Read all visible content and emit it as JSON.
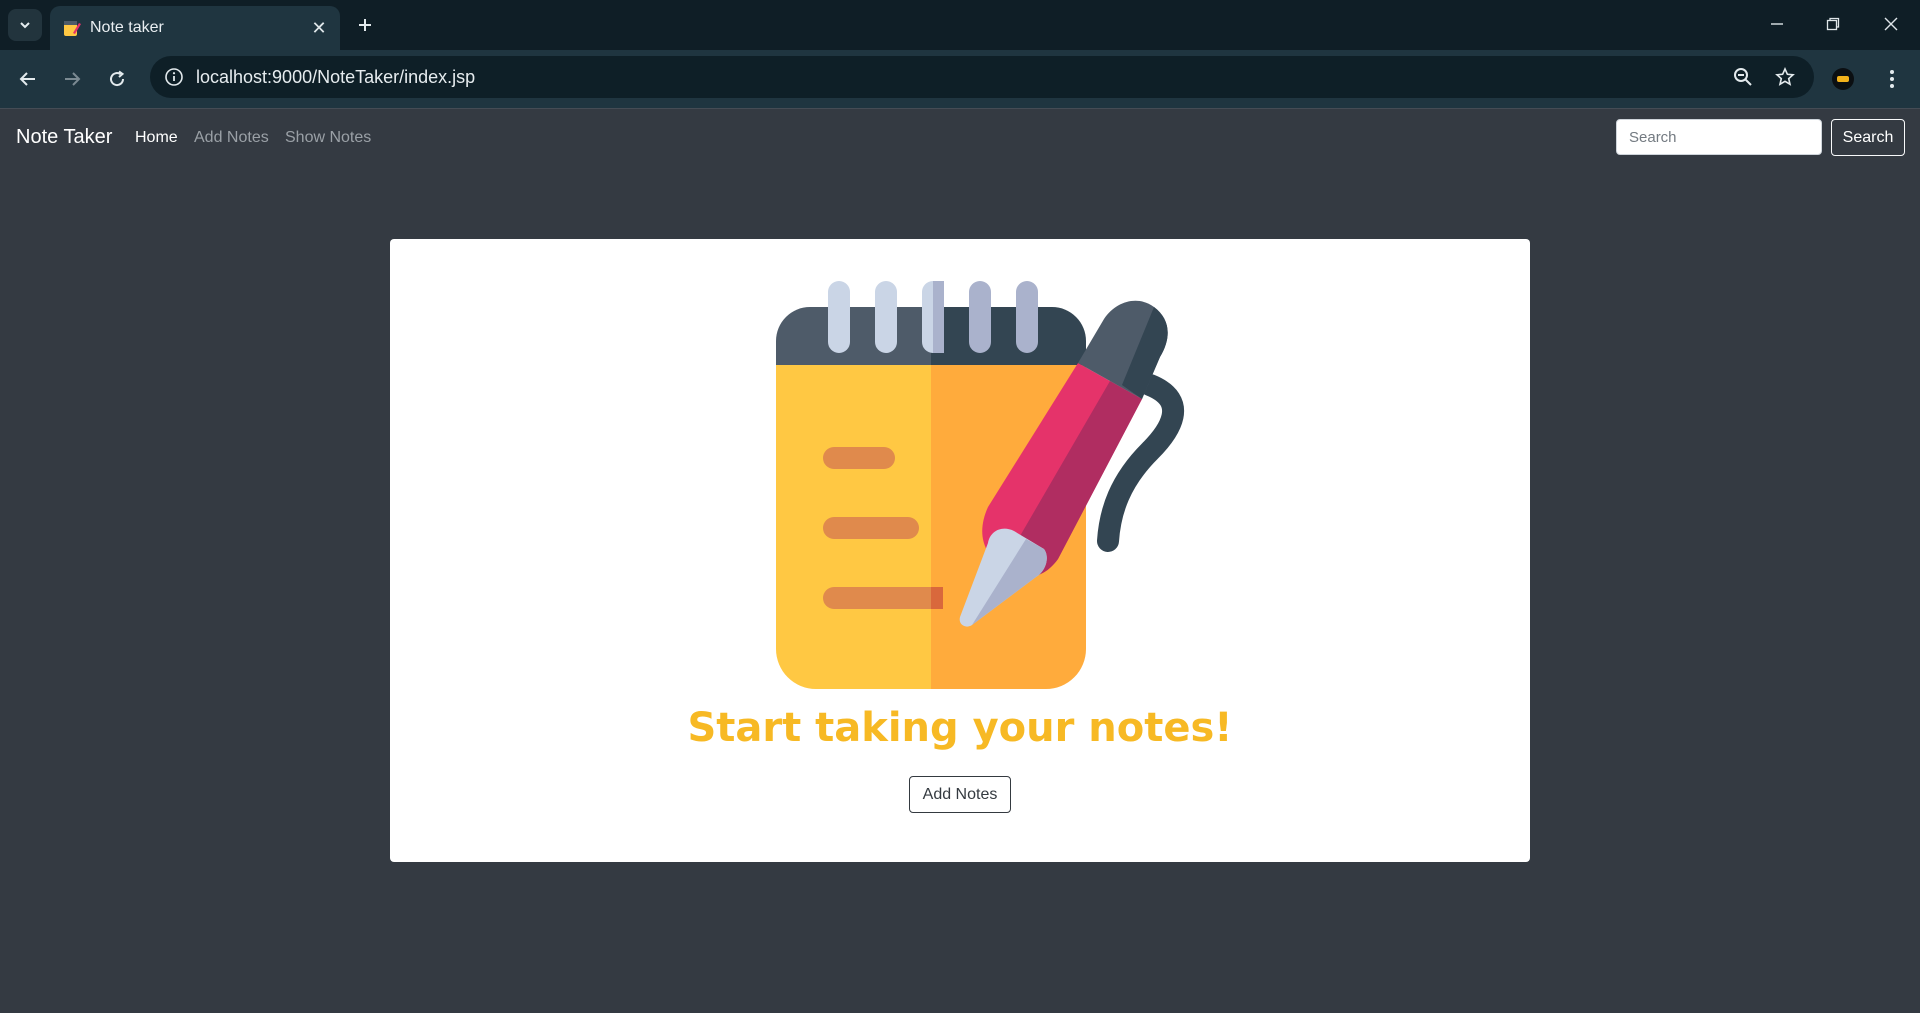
{
  "browser": {
    "tab_title": "Note taker",
    "url": "localhost:9000/NoteTaker/index.jsp"
  },
  "navbar": {
    "brand": "Note Taker",
    "links": [
      {
        "label": "Home",
        "active": true
      },
      {
        "label": "Add Notes",
        "active": false
      },
      {
        "label": "Show Notes",
        "active": false
      }
    ],
    "search_placeholder": "Search",
    "search_button": "Search"
  },
  "main": {
    "headline": "Start taking your notes!",
    "add_notes_button": "Add Notes",
    "illustration": "notepad-with-pen-icon"
  },
  "colors": {
    "page_bg": "#343a42",
    "headline": "#f7b924",
    "browser_frame": "#0f1e26",
    "toolbar": "#1f3540"
  }
}
